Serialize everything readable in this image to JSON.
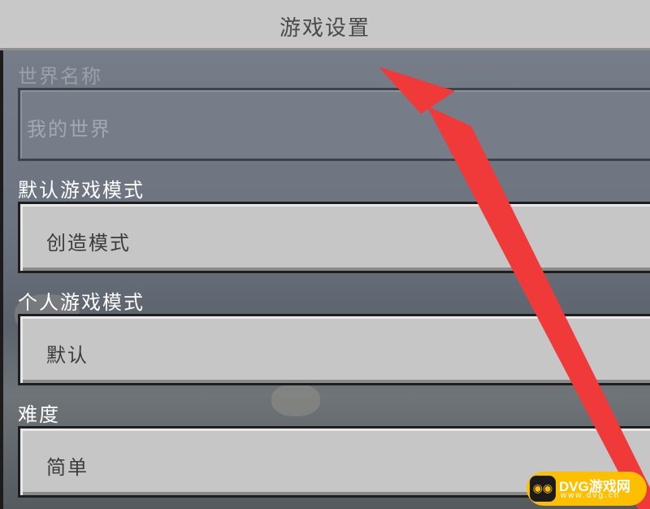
{
  "header": {
    "title": "游戏设置"
  },
  "world_name": {
    "label": "世界名称",
    "value": "我的世界"
  },
  "default_game_mode": {
    "label": "默认游戏模式",
    "value": "创造模式"
  },
  "personal_game_mode": {
    "label": "个人游戏模式",
    "value": "默认"
  },
  "difficulty": {
    "label": "难度",
    "value": "简单"
  },
  "annotation": {
    "color": "#f03a3a"
  },
  "watermark": {
    "text": "DVG游戏网",
    "sub": "www.dvg.cn",
    "color": "#fdbf00"
  }
}
